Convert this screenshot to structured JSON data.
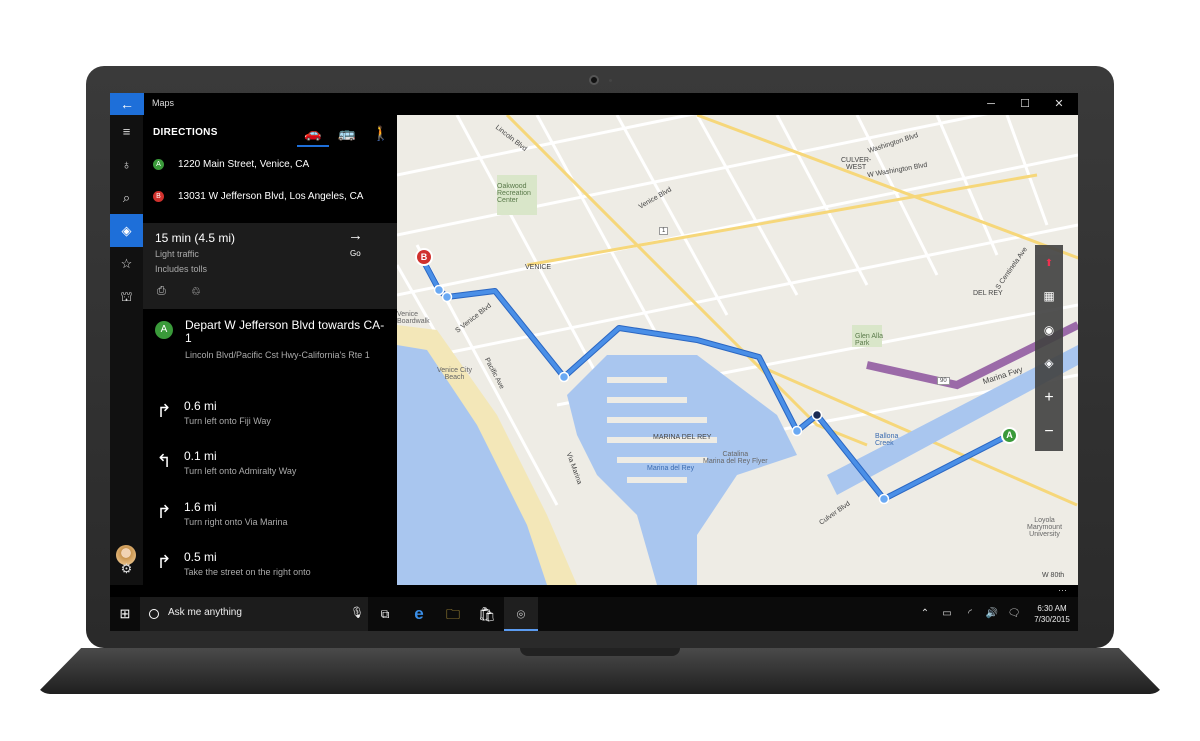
{
  "window": {
    "title": "Maps",
    "minimize": "─",
    "maximize": "☐",
    "close": "✕",
    "back": "←"
  },
  "rail": {
    "menu": "≡",
    "nearby": "♁",
    "search": "⌕",
    "directions": "◈",
    "favorites": "☆",
    "collections": "⛫",
    "settings": "⚙"
  },
  "directions": {
    "title": "DIRECTIONS",
    "modes": [
      "🚗",
      "🚌",
      "🚶"
    ],
    "from": {
      "pin": "A",
      "address": "1220 Main Street, Venice, CA"
    },
    "to": {
      "pin": "B",
      "address": "13031 W Jefferson Blvd, Los Angeles, CA"
    },
    "summary": {
      "time": "15 min (4.5 mi)",
      "traffic": "Light traffic",
      "tolls": "Includes tolls",
      "go_label": "Go",
      "go_icon": "→",
      "print_icon": "⎙",
      "share_icon": "♲"
    },
    "depart": {
      "pin": "A",
      "main": "Depart W Jefferson Blvd towards CA-1",
      "sub": "Lincoln Blvd/Pacific Cst Hwy-California's Rte 1"
    },
    "steps": [
      {
        "turn": "↱",
        "dist": "0.6 mi",
        "desc": "Turn left onto Fiji Way"
      },
      {
        "turn": "↰",
        "dist": "0.1 mi",
        "desc": "Turn left onto Admiralty Way"
      },
      {
        "turn": "↱",
        "dist": "1.6 mi",
        "desc": "Turn right onto Via Marina"
      },
      {
        "turn": "↱",
        "dist": "0.5 mi",
        "desc": "Take the street on the right onto"
      }
    ]
  },
  "map": {
    "labels": {
      "lincoln": "Lincoln Blvd",
      "washington1": "Washington Blvd",
      "washington2": "W Washington Blvd",
      "culverwest": "CULVER-\nWEST",
      "oakwood": "Oakwood\nRecreation\nCenter",
      "venice_blvd": "Venice Blvd",
      "venice": "VENICE",
      "delrey": "DEL REY",
      "marina": "MARINA DEL REY",
      "marina_fwy": "Marina Fwy",
      "centinela": "S Centinela Ave",
      "culver_blvd": "Culver Blvd",
      "ballona": "Ballona\nCreek",
      "loyola": "Loyola\nMarymount\nUniversity",
      "catalina": "Catalina\nMarina del Rey Flyer",
      "marina_beach": "Marina del Rey",
      "venice_beach": "Venice City\nBeach",
      "venice_boardwalk": "Venice\nBoardwalk",
      "glen_alla": "Glen Alla\nPark",
      "via_marina": "Via Marina",
      "pacific": "Pacific Ave",
      "s_venice": "S Venice Blvd",
      "w80": "W 80th",
      "route90": "90",
      "route1": "1"
    },
    "pin_a": "A",
    "pin_b": "B",
    "controls": [
      "⬆",
      "▦",
      "◉",
      "◈",
      "+",
      "−"
    ],
    "colors": {
      "route": "#4a8fe7",
      "route_outline": "#2a66c2",
      "water": "#a9c6ef",
      "beach": "#f3e7b8",
      "freeway": "#9b6aa8"
    }
  },
  "taskbar": {
    "start": "⊞",
    "search_placeholder": "Ask me anything",
    "mic": "🎙",
    "apps": [
      "⧉",
      "e",
      "🗀",
      "🛍",
      "⌾"
    ],
    "tray": [
      "⌃",
      "▭",
      "◜",
      "🔊",
      "🗨"
    ],
    "time": "6:30 AM",
    "date": "7/30/2015",
    "more": "···"
  }
}
